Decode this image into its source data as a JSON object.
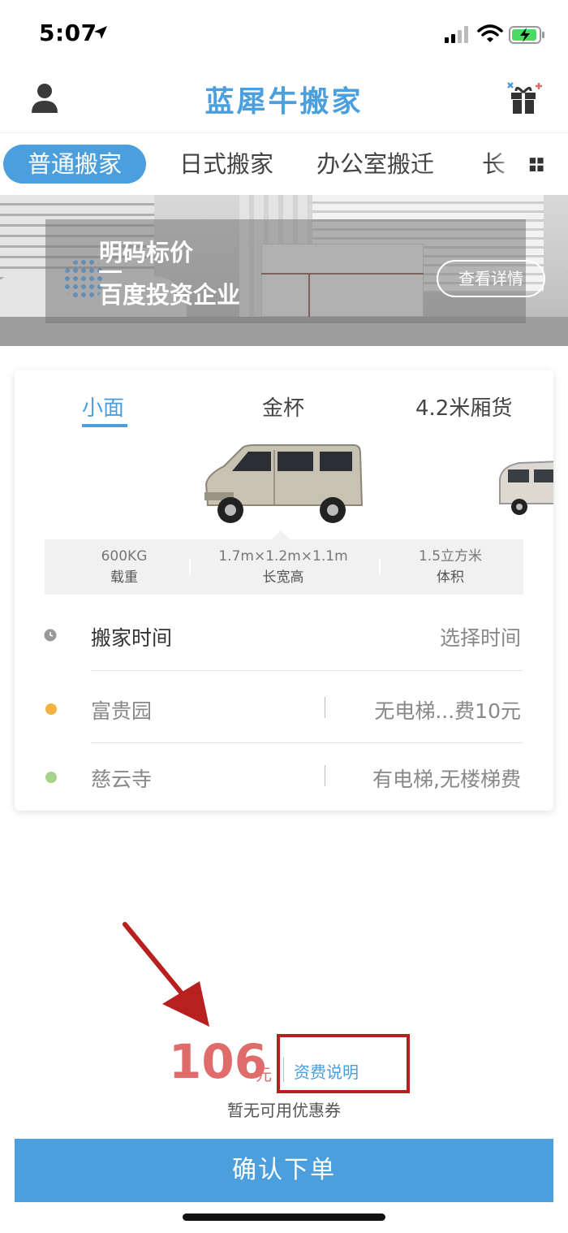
{
  "status_bar": {
    "time": "5:07"
  },
  "header": {
    "title": "蓝犀牛搬家"
  },
  "category_tabs": [
    {
      "label": "普通搬家",
      "active": true
    },
    {
      "label": "日式搬家",
      "active": false
    },
    {
      "label": "办公室搬迁",
      "active": false
    },
    {
      "label": "长",
      "active": false
    }
  ],
  "banner": {
    "line1": "明码标价",
    "line2": "百度投资企业",
    "button": "查看详情"
  },
  "vehicle_tabs": [
    {
      "label": "小面",
      "active": true
    },
    {
      "label": "金杯",
      "active": false
    },
    {
      "label": "4.2米厢货",
      "active": false
    }
  ],
  "specs": [
    {
      "value": "600KG",
      "label": "载重"
    },
    {
      "value": "1.7m×1.2m×1.1m",
      "label": "长宽高"
    },
    {
      "value": "1.5立方米",
      "label": "体积"
    }
  ],
  "move_time": {
    "label": "搬家时间",
    "action": "选择时间"
  },
  "origin": {
    "name": "富贵园",
    "detail": "无电梯...费10元",
    "dot_color": "#f3b240"
  },
  "destination": {
    "name": "慈云寺",
    "detail": "有电梯,无楼梯费",
    "dot_color": "#a6d38c"
  },
  "price": {
    "amount": "106",
    "unit": "元",
    "fee_link": "资费说明",
    "coupon": "暂无可用优惠券"
  },
  "confirm_button": "确认下单",
  "colors": {
    "accent": "#4a9fdc",
    "price": "#e06b6b",
    "highlight": "#b81f1f"
  }
}
